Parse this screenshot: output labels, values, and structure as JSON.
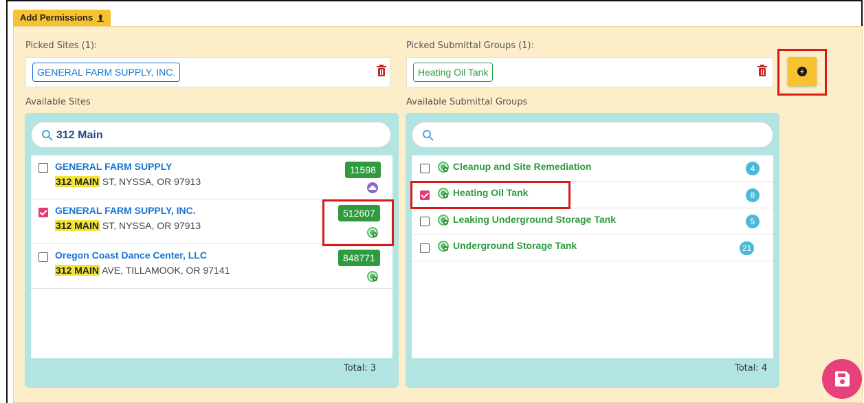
{
  "tab": {
    "label": "Add Permissions",
    "icon": "upload-icon"
  },
  "picked_sites": {
    "label": "Picked Sites (1):",
    "chips": [
      "GENERAL FARM SUPPLY, INC."
    ]
  },
  "picked_groups": {
    "label": "Picked Submittal Groups (1):",
    "chips": [
      "Heating Oil Tank"
    ]
  },
  "available_sites": {
    "label": "Available Sites",
    "search_value": "312 Main",
    "items": [
      {
        "name": "GENERAL FARM SUPPLY",
        "addr_highlight": "312 MAIN",
        "addr_rest": " ST, NYSSA, OR 97913",
        "id": "11598",
        "checked": false,
        "icon": "cloud-icon"
      },
      {
        "name": "GENERAL FARM SUPPLY, INC.",
        "addr_highlight": "312 MAIN",
        "addr_rest": " ST, NYSSA, OR 97913",
        "id": "512607",
        "checked": true,
        "icon": "green-add-icon"
      },
      {
        "name": "Oregon Coast Dance Center, LLC",
        "addr_highlight": "312 MAIN",
        "addr_rest": " AVE, TILLAMOOK, OR 97141",
        "id": "848771",
        "checked": false,
        "icon": "green-add-icon"
      }
    ],
    "total": "Total: 3"
  },
  "available_groups": {
    "label": "Available Submittal Groups",
    "search_value": "",
    "items": [
      {
        "name": "Cleanup and Site Remediation",
        "count": "4",
        "checked": false
      },
      {
        "name": "Heating Oil Tank",
        "count": "8",
        "checked": true
      },
      {
        "name": "Leaking Underground Storage Tank",
        "count": "5",
        "checked": false
      },
      {
        "name": "Underground Storage Tank",
        "count": "21",
        "checked": false
      }
    ],
    "total": "Total: 4"
  },
  "colors": {
    "accent_yellow": "#f6c22f",
    "panel_bg": "#fbeec8",
    "list_bg": "#b2e4e1",
    "site_blue": "#1976d2",
    "group_green": "#2e9b3f",
    "check_pink": "#e23b6e",
    "count_blue": "#4bb8d6",
    "highlight_red": "#d81a1a",
    "fab_pink": "#e8407a"
  }
}
